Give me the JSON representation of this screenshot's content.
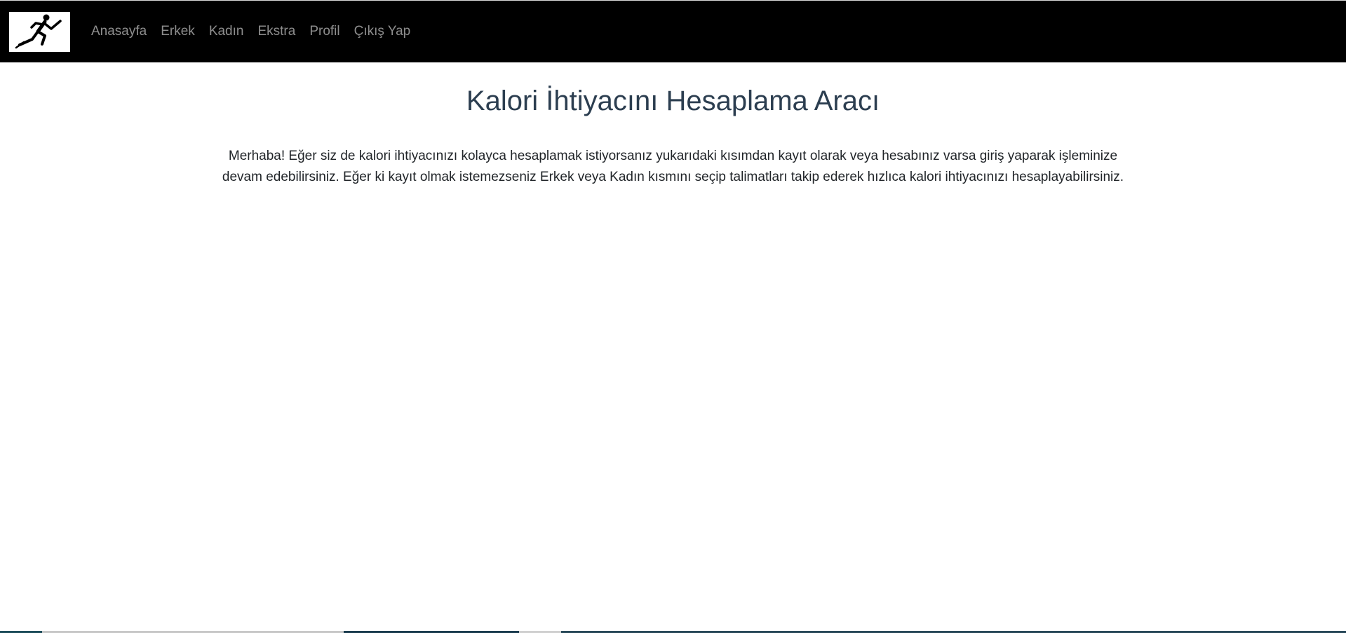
{
  "navbar": {
    "logo_icon": "running-person-icon",
    "links": [
      "Anasayfa",
      "Erkek",
      "Kadın",
      "Ekstra",
      "Profil",
      "Çıkış Yap"
    ]
  },
  "main": {
    "title": "Kalori İhtiyacını Hesaplama Aracı",
    "intro": "Merhaba! Eğer siz de kalori ihtiyacınızı kolayca hesaplamak istiyorsanız yukarıdaki kısımdan kayıt olarak veya hesabınız varsa giriş yaparak işleminize devam edebilirsiniz. Eğer ki kayıt olmak istemezseniz Erkek veya Kadın kısmını seçip talimatları takip ederek hızlıca kalori ihtiyacınızı hesaplayabilirsiniz."
  },
  "colors": {
    "navbar_bg": "#000000",
    "nav_link": "#8c8c8c",
    "title": "#2c3e50",
    "text": "#212529"
  }
}
